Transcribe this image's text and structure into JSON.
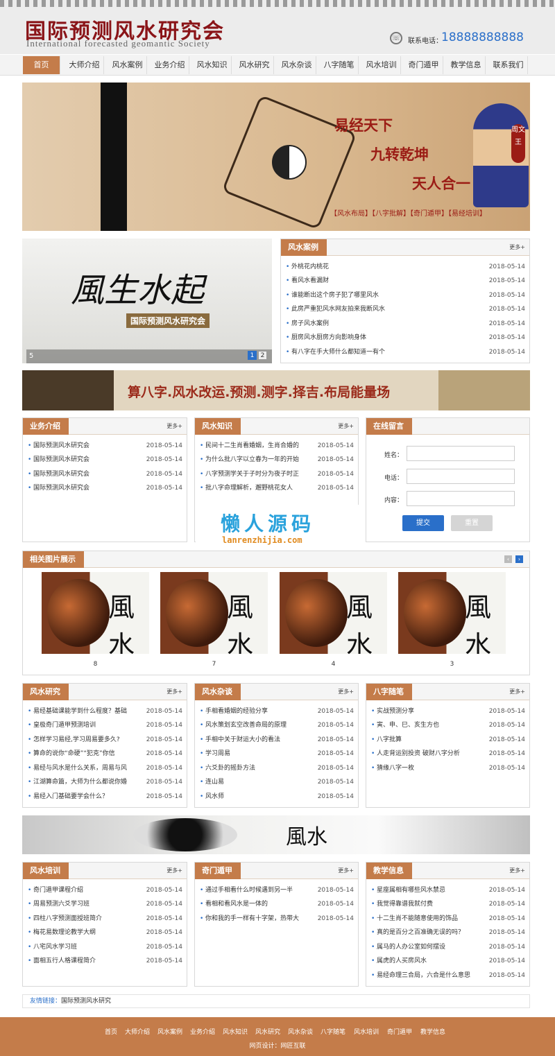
{
  "header": {
    "logo_cn": "国际预测风水研究会",
    "logo_en": "International forecasted geomantic Society",
    "phone_label": "联系电话：",
    "phone_number": "18888888888"
  },
  "nav": [
    "首页",
    "大师介绍",
    "风水案例",
    "业务介绍",
    "风水知识",
    "风水研究",
    "风水杂谈",
    "八字随笔",
    "风水培训",
    "奇门遁甲",
    "教学信息",
    "联系我们"
  ],
  "hero": {
    "line1": "易经天下",
    "line2": "九转乾坤",
    "line3": "天人合一",
    "tags": "【风水布局】【八字批解】【奇门遁甲】【易经培训】",
    "badge": "周文王"
  },
  "slider": {
    "calligraphy": "風生水起",
    "subtitle": "国际预测风水研究会",
    "caption": "5",
    "pages": [
      "1",
      "2"
    ]
  },
  "more": "更多+",
  "fengshui_cases": {
    "title": "风水案例",
    "items": [
      {
        "text": "外桃花内桃花",
        "date": "2018-05-14"
      },
      {
        "text": "看风水看漏财",
        "date": "2018-05-14"
      },
      {
        "text": "谁能断出这个房子犯了哪里风水",
        "date": "2018-05-14"
      },
      {
        "text": "此房严重犯风水网友拍来我断风水",
        "date": "2018-05-14"
      },
      {
        "text": "房子风水案例",
        "date": "2018-05-14"
      },
      {
        "text": "厨房风水厨房方向影响身体",
        "date": "2018-05-14"
      },
      {
        "text": "有八字在手大师什么都知道一有个",
        "date": "2018-05-14"
      }
    ]
  },
  "band_text": "算八字.风水改运.预测.测字.择吉.布局能量场",
  "business": {
    "title": "业务介绍",
    "items": [
      {
        "text": "国际预测风水研究会",
        "date": "2018-05-14"
      },
      {
        "text": "国际预测风水研究会",
        "date": "2018-05-14"
      },
      {
        "text": "国际预测风水研究会",
        "date": "2018-05-14"
      },
      {
        "text": "国际预测风水研究会",
        "date": "2018-05-14"
      }
    ]
  },
  "knowledge": {
    "title": "风水知识",
    "items": [
      {
        "text": "民间十二生肖看婚姻，生肖合婚的",
        "date": "2018-05-14"
      },
      {
        "text": "为什么批八字以立春为一年的开始",
        "date": "2018-05-14"
      },
      {
        "text": "八字预测学关于子时分为夜子时正",
        "date": "2018-05-14"
      },
      {
        "text": "批八字命理解析，邂野桃花女人",
        "date": "2018-05-14"
      }
    ]
  },
  "message": {
    "title": "在线留言",
    "name_label": "姓名：",
    "phone_label": "电话：",
    "content_label": "内容：",
    "submit": "提交",
    "reset": "重置"
  },
  "watermark": {
    "cn": "懒人源码",
    "en": "lanrenzhijia.com"
  },
  "gallery": {
    "title": "相关图片展示",
    "items": [
      {
        "char": "風水",
        "caption": "8"
      },
      {
        "char": "風水",
        "caption": "7"
      },
      {
        "char": "風水",
        "caption": "4"
      },
      {
        "char": "風水",
        "caption": "3"
      }
    ]
  },
  "research": {
    "title": "风水研究",
    "items": [
      {
        "text": "易经基础课能学到什么程度？基础",
        "date": "2018-05-14"
      },
      {
        "text": "皇极奇门遁甲预测培训",
        "date": "2018-05-14"
      },
      {
        "text": "怎样学习易经,学习周易要多久?",
        "date": "2018-05-14"
      },
      {
        "text": "算命的说你“命硬”“犯克”你信",
        "date": "2018-05-14"
      },
      {
        "text": "易经与风水是什么关系，周易与风",
        "date": "2018-05-14"
      },
      {
        "text": "江湖算命篇，大师为什么都说你婚",
        "date": "2018-05-14"
      },
      {
        "text": "易经入门基础要学会什么？",
        "date": "2018-05-14"
      }
    ]
  },
  "talk": {
    "title": "风水杂谈",
    "items": [
      {
        "text": "手相看婚姻的经验分享",
        "date": "2018-05-14"
      },
      {
        "text": "风水策划玄空改善命局的原理",
        "date": "2018-05-14"
      },
      {
        "text": "手相中关于财运大小的看法",
        "date": "2018-05-14"
      },
      {
        "text": "学习周易",
        "date": "2018-05-14"
      },
      {
        "text": "六爻卦的摇卦方法",
        "date": "2018-05-14"
      },
      {
        "text": "连山易",
        "date": "2018-05-14"
      },
      {
        "text": "风水师",
        "date": "2018-05-14"
      }
    ]
  },
  "bazi": {
    "title": "八字随笔",
    "items": [
      {
        "text": "实战预测分享",
        "date": "2018-05-14"
      },
      {
        "text": "寅、申、巳、亥生方也",
        "date": "2018-05-14"
      },
      {
        "text": "八字批算",
        "date": "2018-05-14"
      },
      {
        "text": "人走背运别投资 破财八字分析",
        "date": "2018-05-14"
      },
      {
        "text": "猜缘八字一枚",
        "date": "2018-05-14"
      }
    ]
  },
  "band2": {
    "calligraphy": "風水"
  },
  "training": {
    "title": "风水培训",
    "items": [
      {
        "text": "奇门遁甲课程介绍",
        "date": "2018-05-14"
      },
      {
        "text": "周易预测六爻学习班",
        "date": "2018-05-14"
      },
      {
        "text": "四柱八字预测面授班简介",
        "date": "2018-05-14"
      },
      {
        "text": "梅花易数理论教学大纲",
        "date": "2018-05-14"
      },
      {
        "text": "八宅风水学习班",
        "date": "2018-05-14"
      },
      {
        "text": "面相五行人格课程简介",
        "date": "2018-05-14"
      }
    ]
  },
  "qimen": {
    "title": "奇门遁甲",
    "items": [
      {
        "text": "通过手相看什么时候遇到另一半",
        "date": "2018-05-14"
      },
      {
        "text": "看相和看风水是一体的",
        "date": "2018-05-14"
      },
      {
        "text": "你和我的手一样有十字架，热带大",
        "date": "2018-05-14"
      }
    ]
  },
  "teaching": {
    "title": "教学信息",
    "items": [
      {
        "text": "星座属相有哪些风水禁忌",
        "date": "2018-05-14"
      },
      {
        "text": "我觉得靠谱我就付费",
        "date": "2018-05-14"
      },
      {
        "text": "十二生肖不能随意使用的饰品",
        "date": "2018-05-14"
      },
      {
        "text": "真的是百分之百准确无误的吗？",
        "date": "2018-05-14"
      },
      {
        "text": "属马的人办公室如何摆设",
        "date": "2018-05-14"
      },
      {
        "text": "属虎的人买房风水",
        "date": "2018-05-14"
      },
      {
        "text": "易经命理三合局，六合是什么意思",
        "date": "2018-05-14"
      }
    ]
  },
  "links": {
    "label": "友情链接：",
    "item": "国际预测风水研究"
  },
  "footer": {
    "nav": [
      "首页",
      "大师介绍",
      "风水案例",
      "业务介绍",
      "风水知识",
      "风水研究",
      "风水杂谈",
      "八字随笔",
      "风水培训",
      "奇门遁甲",
      "教学信息"
    ],
    "credit": "网页设计：网匠互联"
  },
  "colors": {
    "accent": "#c47c4a",
    "link": "#2a6fc9",
    "brand": "#8a1418"
  }
}
